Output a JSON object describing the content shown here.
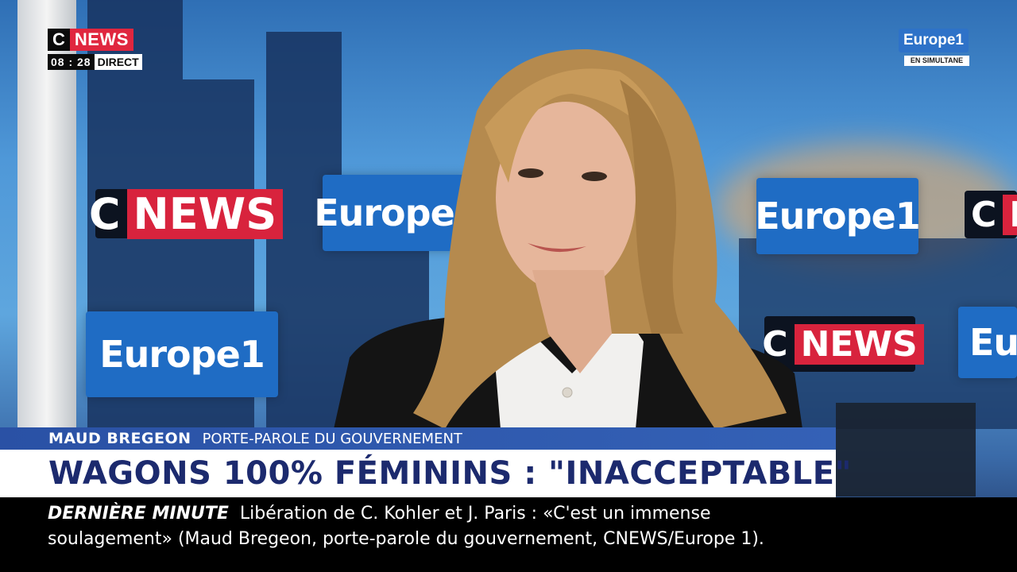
{
  "channel": {
    "logo_c": "C",
    "logo_news": "NEWS",
    "time": "08 : 28",
    "live_label": "DIRECT"
  },
  "partner": {
    "logo": "Europe1",
    "sub_label": "EN SIMULTANE"
  },
  "studio_logos": {
    "europe_text": "Europe1",
    "cnews_c": "C",
    "cnews_news": "NEWS"
  },
  "lower_third": {
    "name": "MAUD BREGEON",
    "role": "PORTE-PAROLE DU GOUVERNEMENT",
    "headline": "WAGONS 100% FÉMININS : \"INACCEPTABLE\""
  },
  "ticker": {
    "label": "DERNIÈRE MINUTE",
    "line1": "Libération de C. Kohler et J. Paris : «C'est un immense",
    "line2": "soulagement» (Maud Bregeon, porte-parole du gouvernement, CNEWS/Europe 1)."
  },
  "colors": {
    "accent_red": "#e0263f",
    "name_bar_blue": "#2a51a5",
    "headline_navy": "#1c2a6e",
    "europe_blue": "#2e72c8"
  }
}
